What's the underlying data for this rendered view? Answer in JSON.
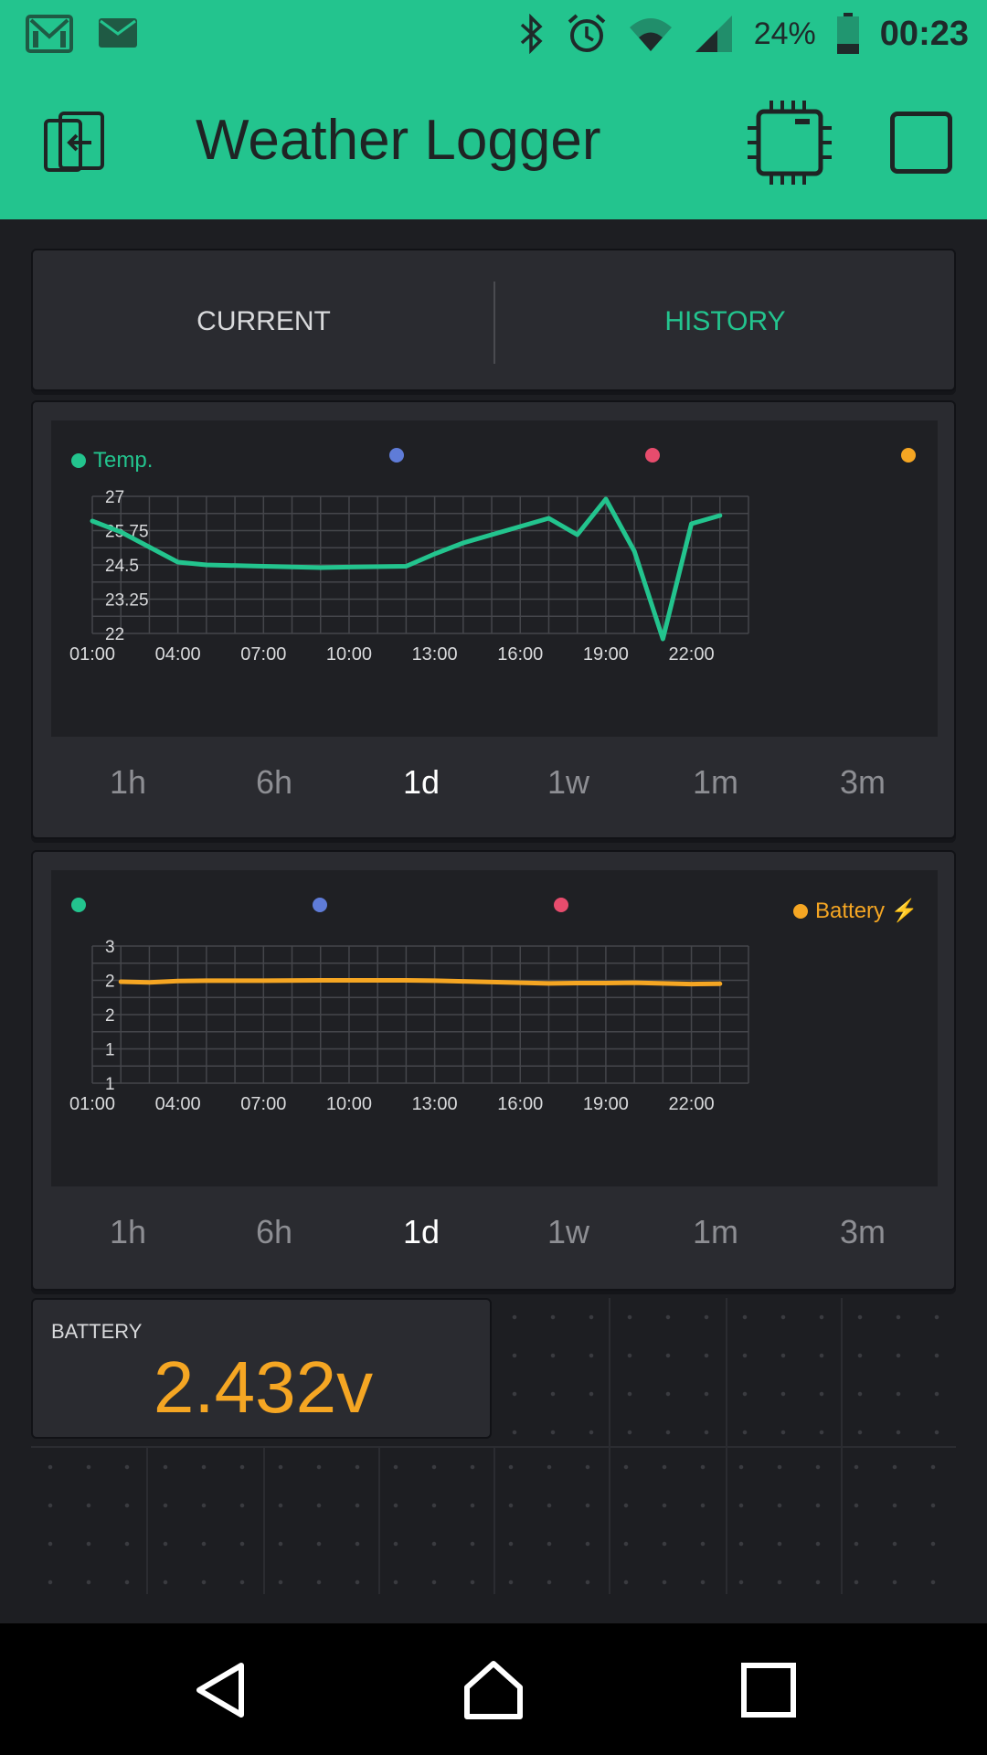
{
  "status_bar": {
    "battery_percent": "24%",
    "time": "00:23",
    "icons": [
      "gmail-icon",
      "email-icon",
      "bluetooth-icon",
      "alarm-icon",
      "wifi-icon",
      "signal-icon",
      "battery-icon"
    ]
  },
  "app_bar": {
    "title": "Weather Logger",
    "icons": [
      "exit-icon",
      "chip-icon",
      "stop-square-icon"
    ],
    "accent": "#23c48e"
  },
  "tabs": {
    "current_label": "CURRENT",
    "history_label": "HISTORY",
    "active": "HISTORY"
  },
  "periods": [
    "1h",
    "6h",
    "1d",
    "1w",
    "1m",
    "3m"
  ],
  "active_period": "1d",
  "chart_data": [
    {
      "type": "line",
      "legend": [
        {
          "name": "Temp.",
          "color": "#23c48e"
        },
        {
          "name": "",
          "color": "#5f7cd8"
        },
        {
          "name": "",
          "color": "#e74c6d"
        },
        {
          "name": "",
          "color": "#f5a623"
        }
      ],
      "x_ticks": [
        "01:00",
        "04:00",
        "07:00",
        "10:00",
        "13:00",
        "16:00",
        "19:00",
        "22:00"
      ],
      "y_ticks": [
        "27",
        "25.75",
        "24.5",
        "23.25",
        "22"
      ],
      "ylim": [
        22,
        27
      ],
      "x_hours": [
        1.0,
        2.0,
        4.0,
        5.0,
        7.0,
        9.0,
        10.0,
        12.0,
        13.0,
        14.0,
        16.0,
        17.0,
        18.0,
        19.0,
        20.0,
        21.0,
        22.0,
        23.0
      ],
      "series": [
        {
          "name": "Temp.",
          "color": "#23c48e",
          "values": [
            26.1,
            25.7,
            24.6,
            24.5,
            24.45,
            24.4,
            24.42,
            24.45,
            24.9,
            25.3,
            25.9,
            26.2,
            25.6,
            26.9,
            25.0,
            21.8,
            26.0,
            26.3
          ]
        }
      ]
    },
    {
      "type": "line",
      "legend": [
        {
          "name": "",
          "color": "#23c48e"
        },
        {
          "name": "",
          "color": "#5f7cd8"
        },
        {
          "name": "",
          "color": "#e74c6d"
        },
        {
          "name": "Battery ⚡",
          "color": "#f5a623"
        }
      ],
      "x_ticks": [
        "01:00",
        "04:00",
        "07:00",
        "10:00",
        "13:00",
        "16:00",
        "19:00",
        "22:00"
      ],
      "y_ticks": [
        "3",
        "2",
        "2",
        "1",
        "1"
      ],
      "ylim": [
        1,
        3
      ],
      "x_hours": [
        2.0,
        3.0,
        4.0,
        5.0,
        7.0,
        9.0,
        10.0,
        12.0,
        13.0,
        14.0,
        16.0,
        17.0,
        18.0,
        19.0,
        20.0,
        21.0,
        22.0,
        23.0
      ],
      "series": [
        {
          "name": "Battery ⚡",
          "color": "#f5a623",
          "values": [
            2.48,
            2.47,
            2.49,
            2.495,
            2.495,
            2.5,
            2.5,
            2.5,
            2.495,
            2.485,
            2.465,
            2.455,
            2.46,
            2.46,
            2.465,
            2.455,
            2.445,
            2.45
          ]
        }
      ]
    }
  ],
  "battery_widget": {
    "label": "BATTERY",
    "value": "2.432v",
    "color": "#f5a623"
  }
}
